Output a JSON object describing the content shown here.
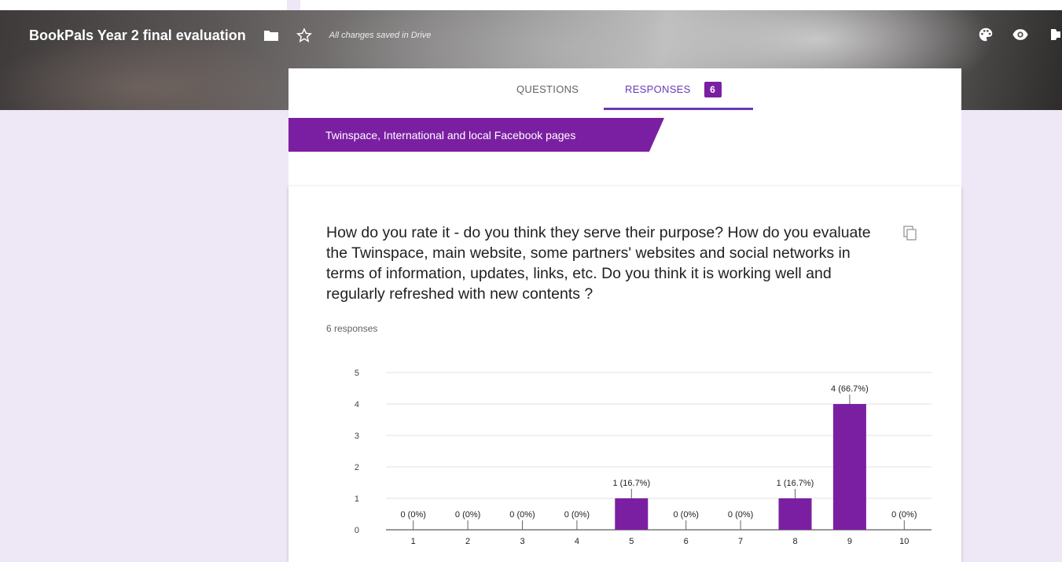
{
  "header": {
    "doc_title": "BookPals Year 2 final evaluation",
    "save_status": "All changes saved in Drive",
    "icons": [
      "folder-icon",
      "star-icon",
      "palette-icon",
      "eye-icon",
      "settings-icon"
    ]
  },
  "tabs": {
    "questions_label": "QUESTIONS",
    "responses_label": "RESPONSES",
    "responses_count": "6"
  },
  "section": {
    "title": "Twinspace, International and local Facebook pages"
  },
  "question": {
    "text": "How do you rate it - do you think they serve their purpose? How do you evaluate the Twinspace, main website, some partners' websites and social networks in terms of information, updates, links, etc. Do you think it is working well and regularly refreshed with new contents ?",
    "responses_label": "6 responses"
  },
  "colors": {
    "accent": "#673ab7",
    "bar": "#7b1fa2",
    "background": "#ede7f6"
  },
  "chart_data": {
    "type": "bar",
    "categories": [
      "1",
      "2",
      "3",
      "4",
      "5",
      "6",
      "7",
      "8",
      "9",
      "10"
    ],
    "values": [
      0,
      0,
      0,
      0,
      1,
      0,
      0,
      1,
      4,
      0
    ],
    "data_labels": [
      "0 (0%)",
      "0 (0%)",
      "0 (0%)",
      "0 (0%)",
      "1 (16.7%)",
      "0 (0%)",
      "0 (0%)",
      "1 (16.7%)",
      "4 (66.7%)",
      "0 (0%)"
    ],
    "yticks": [
      "0",
      "1",
      "2",
      "3",
      "4",
      "5"
    ],
    "ylim": [
      0,
      5
    ],
    "grid": true,
    "legend": "none"
  }
}
